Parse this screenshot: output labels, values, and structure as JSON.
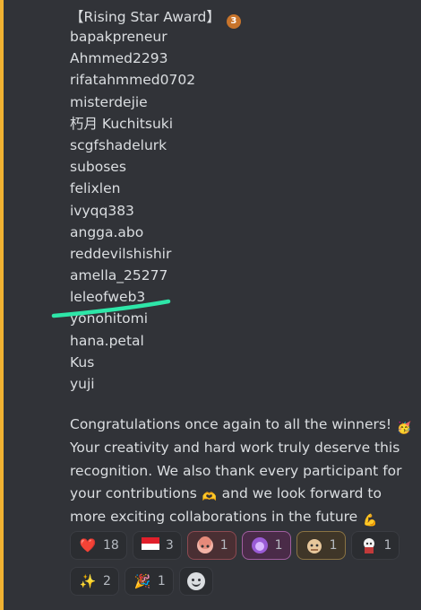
{
  "message": {
    "heading": "【Rising Star Award】",
    "heading_medal": "3",
    "winners": [
      "bapakpreneur",
      "Ahmmed2293",
      "rifatahmmed0702",
      "misterdejie",
      "朽月 Kuchitsuki",
      "scgfshadelurk",
      "suboses",
      "felixlen",
      "ivyqq383",
      "angga.abo",
      "reddevilshishir",
      "amella_25277",
      "leleofweb3",
      "yonohitomi",
      "hana.petal",
      "Kus",
      "yuji"
    ],
    "congrats_1": "Congratulations once again to all the winners! ",
    "congrats_1_emoji": "🥳",
    "congrats_2": "Your creativity and hard work truly deserve this recognition. We also thank every participant for your contributions",
    "congrats_2_emoji": "🫶",
    "congrats_3": " and we look forward to more exciting collaborations in the future",
    "congrats_3_emoji": "💪"
  },
  "reactions": {
    "row1": [
      {
        "icon": "heart-icon",
        "glyph": "❤️",
        "count": "18"
      },
      {
        "icon": "indonesia-flag-icon",
        "glyph": "🇮🇩",
        "count": "3"
      },
      {
        "icon": "custom-emoji-girl-icon",
        "glyph": "",
        "count": "1"
      },
      {
        "icon": "custom-emoji-purple-icon",
        "glyph": "",
        "count": "1"
      },
      {
        "icon": "custom-emoji-dog-icon",
        "glyph": "",
        "count": "1"
      },
      {
        "icon": "custom-emoji-red-icon",
        "glyph": "",
        "count": "1"
      }
    ],
    "row2": [
      {
        "icon": "sparkles-icon",
        "glyph": "✨",
        "count": "2"
      },
      {
        "icon": "party-popper-icon",
        "glyph": "🎉",
        "count": "1"
      }
    ]
  },
  "colors": {
    "background": "#313338",
    "accent": "#f0b232",
    "underline": "#2ee6a8"
  }
}
